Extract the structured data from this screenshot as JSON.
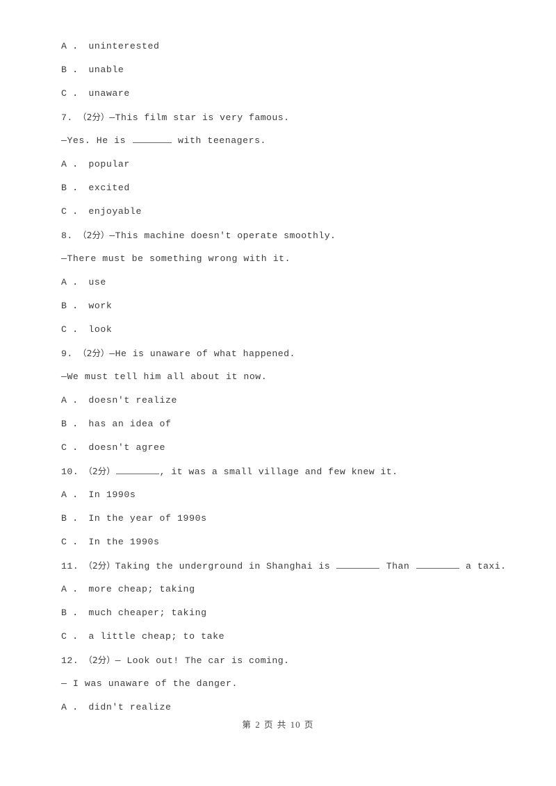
{
  "page": {
    "background_color": "#ffffff",
    "text_color": "#3b3b3b"
  },
  "footer": {
    "prefix": "第",
    "current_page": "2",
    "middle": "页 共",
    "total_pages": "10",
    "suffix": "页",
    "full_text": "第 2 页 共 10 页"
  },
  "lines": [
    {
      "id": "l1",
      "type": "option",
      "text": "A ． uninterested"
    },
    {
      "id": "l2",
      "type": "option",
      "text": "B ． unable"
    },
    {
      "id": "l3",
      "type": "option",
      "text": "C ． unaware"
    },
    {
      "id": "l4",
      "type": "question",
      "number": "7.",
      "score": "（2分）",
      "text": "—This film star is very famous."
    },
    {
      "id": "l5",
      "type": "stem",
      "pre": "—Yes. He is ",
      "blank": "w7",
      "post": " with teenagers."
    },
    {
      "id": "l6",
      "type": "option",
      "text": "A ． popular"
    },
    {
      "id": "l7",
      "type": "option",
      "text": "B ． excited"
    },
    {
      "id": "l8",
      "type": "option",
      "text": "C ． enjoyable"
    },
    {
      "id": "l9",
      "type": "question",
      "number": "8.",
      "score": "（2分）",
      "text": "—This machine doesn't operate smoothly."
    },
    {
      "id": "l10",
      "type": "stem",
      "pre": "—There must be something wrong with it.",
      "blank": null,
      "post": ""
    },
    {
      "id": "l11",
      "type": "option",
      "text": "A ． use"
    },
    {
      "id": "l12",
      "type": "option",
      "text": "B ． work"
    },
    {
      "id": "l13",
      "type": "option",
      "text": "C ． look"
    },
    {
      "id": "l14",
      "type": "question",
      "number": "9.",
      "score": "（2分）",
      "text": "—He is unaware of what happened."
    },
    {
      "id": "l15",
      "type": "stem",
      "pre": "—We must tell him all about it now.",
      "blank": null,
      "post": ""
    },
    {
      "id": "l16",
      "type": "option",
      "text": "A ． doesn't realize"
    },
    {
      "id": "l17",
      "type": "option",
      "text": "B ． has an idea of"
    },
    {
      "id": "l18",
      "type": "option",
      "text": "C ． doesn't agree"
    },
    {
      "id": "l19",
      "type": "question-blank",
      "number": "10.",
      "score": "（2分）",
      "blank": "w8",
      "post": ", it was a small village and few knew it."
    },
    {
      "id": "l20",
      "type": "option",
      "text": "A ． In 1990s"
    },
    {
      "id": "l21",
      "type": "option",
      "text": "B ． In the year of 1990s"
    },
    {
      "id": "l22",
      "type": "option",
      "text": "C ． In the 1990s"
    },
    {
      "id": "l23",
      "type": "question-twoblank",
      "number": "11.",
      "score": "（2分）",
      "pre": "Taking the underground in Shanghai is ",
      "blank1": "w8",
      "mid": " Than ",
      "blank2": "w8",
      "post": " a taxi."
    },
    {
      "id": "l24",
      "type": "option",
      "text": "A ． more cheap; taking"
    },
    {
      "id": "l25",
      "type": "option",
      "text": "B ． much cheaper; taking"
    },
    {
      "id": "l26",
      "type": "option",
      "text": "C ． a little cheap; to take"
    },
    {
      "id": "l27",
      "type": "question",
      "number": "12.",
      "score": "（2分）",
      "text": "— Look out! The car is coming."
    },
    {
      "id": "l28",
      "type": "stem",
      "pre": "— I was unaware of the danger.",
      "blank": null,
      "post": ""
    },
    {
      "id": "l29",
      "type": "option",
      "text": "A ． didn't realize"
    }
  ]
}
